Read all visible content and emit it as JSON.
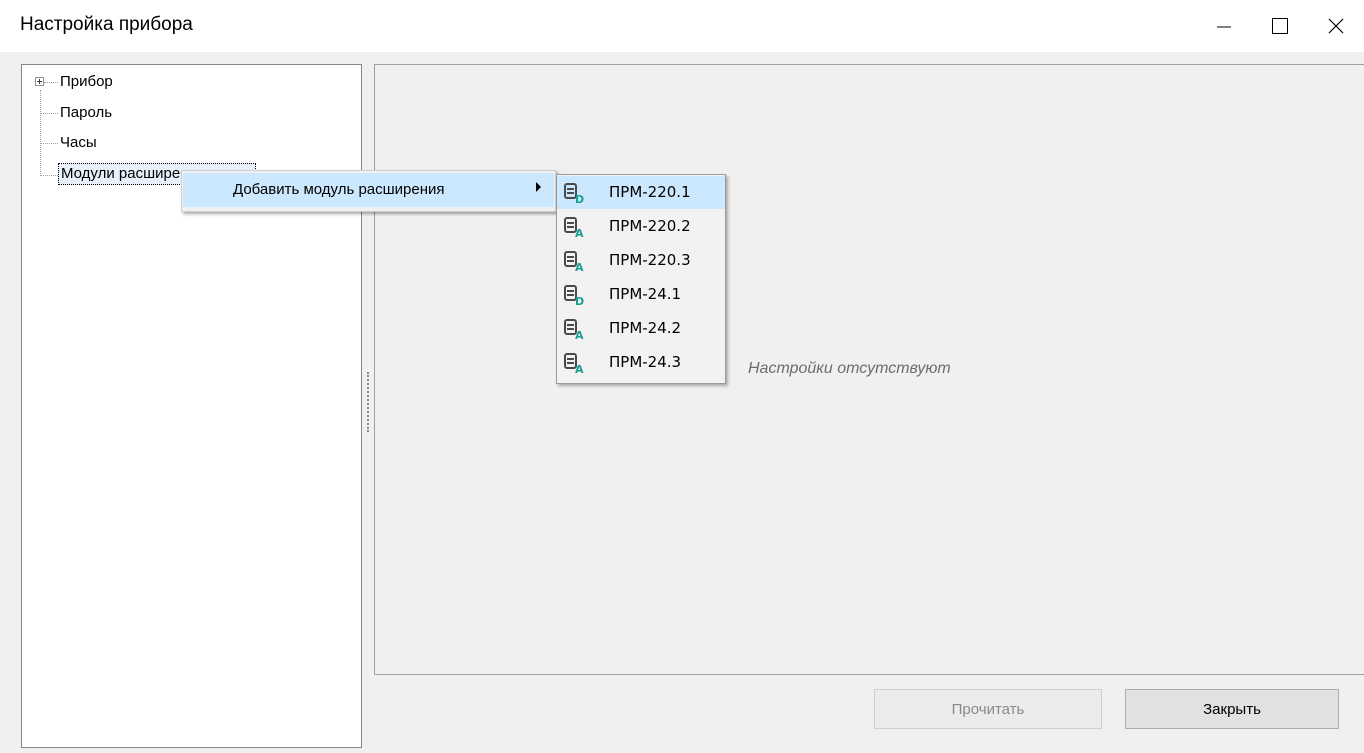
{
  "window": {
    "title": "Настройка прибора",
    "minimize_icon": "minimize-icon",
    "maximize_icon": "maximize-icon",
    "close_icon": "close-icon"
  },
  "tree": {
    "items": [
      {
        "label": "Прибор",
        "expandable": true
      },
      {
        "label": "Пароль"
      },
      {
        "label": "Часы"
      },
      {
        "label": "Модули расширения",
        "selected": true
      }
    ]
  },
  "context_menu": {
    "item_label": "Добавить модуль расширения",
    "submenu": [
      {
        "label": "ПРМ-220.1",
        "icon": "module-d-icon",
        "hover": true
      },
      {
        "label": "ПРМ-220.2",
        "icon": "module-a-icon"
      },
      {
        "label": "ПРМ-220.3",
        "icon": "module-a-icon"
      },
      {
        "label": "ПРМ-24.1",
        "icon": "module-d-icon"
      },
      {
        "label": "ПРМ-24.2",
        "icon": "module-a-icon"
      },
      {
        "label": "ПРМ-24.3",
        "icon": "module-a-icon"
      }
    ]
  },
  "main": {
    "empty_text": "Настройки отсутствуют"
  },
  "buttons": {
    "read_label": "Прочитать",
    "close_label": "Закрыть"
  },
  "colors": {
    "highlight": "#cce8ff",
    "icon_teal": "#1a9e8f",
    "icon_gray": "#4a4a4a"
  }
}
